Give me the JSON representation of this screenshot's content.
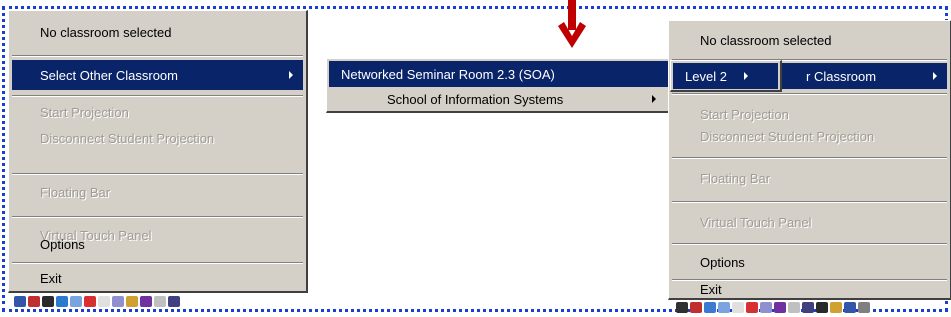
{
  "left_menu": {
    "items": [
      {
        "label": "No classroom selected",
        "state": "normal"
      },
      {
        "label": "Select Other Classroom",
        "state": "selected",
        "submenu": true
      },
      {
        "label": "Start Projection",
        "state": "disabled"
      },
      {
        "label": "Disconnect Student Projection",
        "state": "disabled"
      },
      {
        "label": "Floating Bar",
        "state": "disabled"
      },
      {
        "label": "Virtual Touch Panel",
        "state": "disabled"
      },
      {
        "label": "Options",
        "state": "normal"
      },
      {
        "label": "Exit",
        "state": "normal"
      }
    ]
  },
  "submenu_room": {
    "selected_label": "Networked Seminar Room 2.3 (SOA)",
    "second_label": "School of Information Systems"
  },
  "submenu_level": {
    "label": "Level 2"
  },
  "right_menu": {
    "items": [
      {
        "label": "No classroom selected",
        "state": "normal"
      },
      {
        "label": "r Classroom",
        "state": "selected",
        "submenu": true
      },
      {
        "label": "Start Projection",
        "state": "disabled"
      },
      {
        "label": "Disconnect Student Projection",
        "state": "disabled"
      },
      {
        "label": "Floating Bar",
        "state": "disabled"
      },
      {
        "label": "Virtual Touch Panel",
        "state": "disabled"
      },
      {
        "label": "Options",
        "state": "normal"
      },
      {
        "label": "Exit",
        "state": "normal"
      }
    ]
  },
  "colors": {
    "menu_bg": "#d4d0c8",
    "highlight": "#0a246a",
    "frame": "#1a3fd0",
    "arrow": "#c00000"
  },
  "icons": [
    "arrow-down-icon",
    "submenu-arrow-icon",
    "tray-icon"
  ]
}
